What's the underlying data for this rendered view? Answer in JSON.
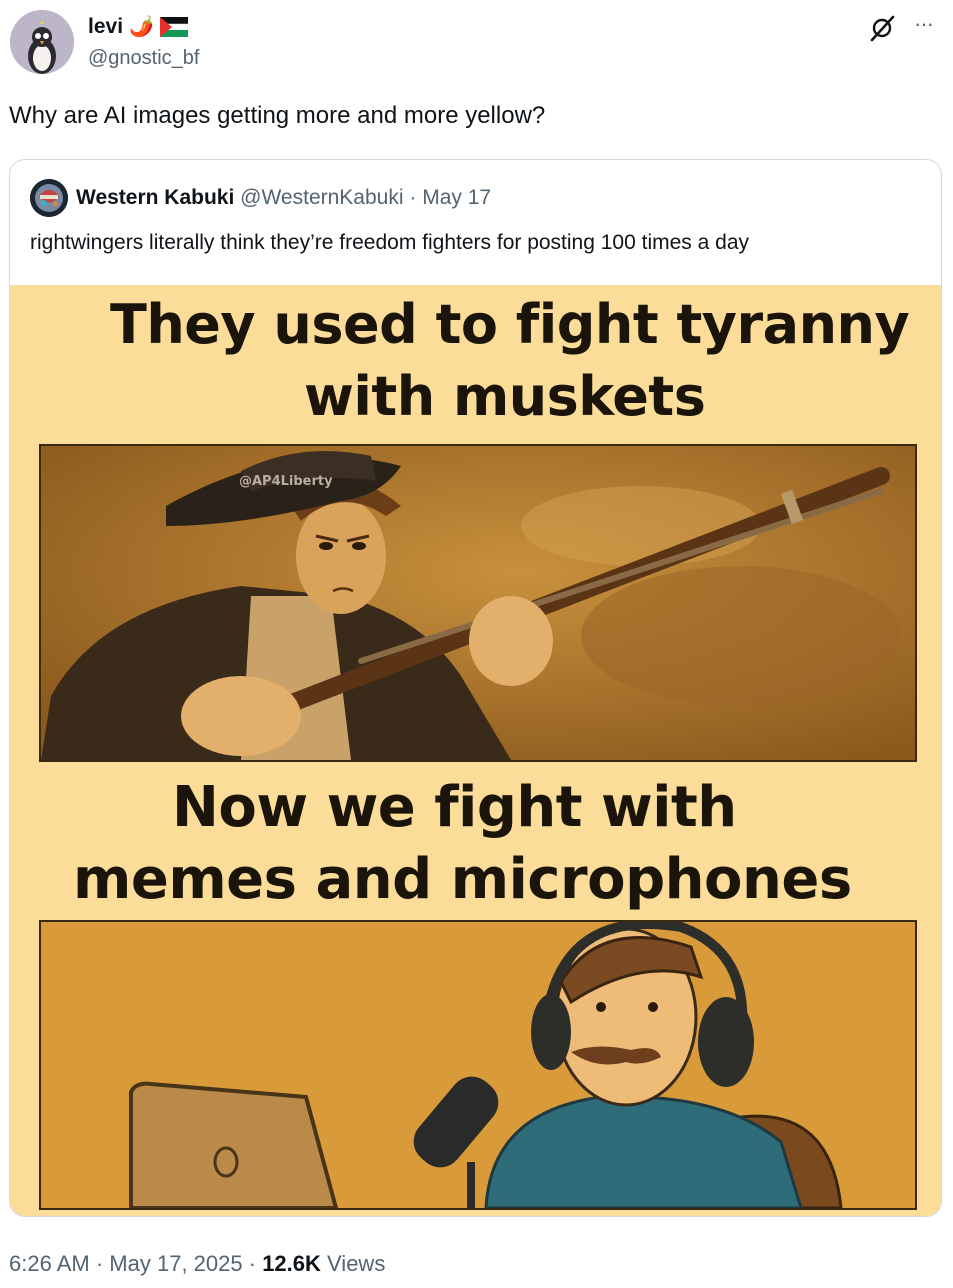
{
  "author": {
    "display_name": "levi",
    "emojis": "🌶️",
    "handle": "@gnostic_bf"
  },
  "icons": {
    "grok": "grok-icon",
    "more": "more-icon",
    "flag": "palestine-flag-icon",
    "pepper": "chili-pepper-icon"
  },
  "more_label": "···",
  "tweet_text": "Why are AI images getting more and more yellow?",
  "quote": {
    "display_name": "Western Kabuki",
    "handle": "@WesternKabuki",
    "separator": "·",
    "date": "May 17",
    "text": "rightwingers literally think they’re freedom fighters for posting 100 times a day",
    "media": {
      "line1": "They used to fight tyranny",
      "line2": "with muskets",
      "watermark": "@AP4Liberty",
      "line3": "Now we fight with",
      "line4": "memes and microphones"
    }
  },
  "footer": {
    "time": "6:26 AM",
    "sep1": "·",
    "date": "May 17, 2025",
    "sep2": "·",
    "views_count": "12.6K",
    "views_label": "Views"
  },
  "colors": {
    "text_primary": "#0f1419",
    "text_secondary": "#536471",
    "border": "#cfd9de",
    "meme_background": "#fbdc98"
  }
}
